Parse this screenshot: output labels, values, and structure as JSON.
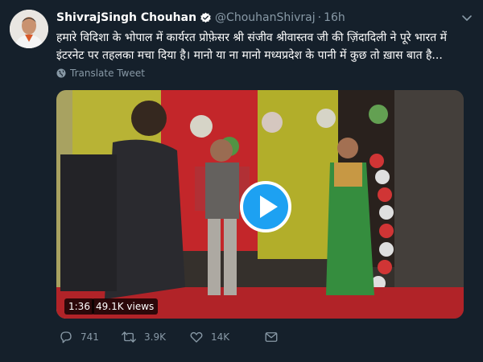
{
  "tweet": {
    "author_name": "ShivrajSingh Chouhan",
    "handle": "@ChouhanShivraj",
    "separator": "·",
    "time": "16h",
    "text": "हमारे विदिशा के भोपाल में कार्यरत प्रोफ़ेसर श्री संजीव श्रीवास्तव जी की ज़िंदादिली ने पूरे भारत में इंटरनेट पर तहलका मचा दिया है। मानो या ना मानो मध्यप्रदेश के पानी में कुछ तो ख़ास बात है...",
    "translate_label": "Translate Tweet",
    "verified_icon": "verified-badge-icon"
  },
  "video": {
    "duration": "1:36",
    "views": "49.1K views",
    "play_icon": "play-icon"
  },
  "actions": {
    "reply_count": "741",
    "retweet_count": "3.9K",
    "like_count": "14K"
  },
  "colors": {
    "background": "#15202b",
    "accent": "#1da1f2",
    "muted": "#8899a6"
  }
}
